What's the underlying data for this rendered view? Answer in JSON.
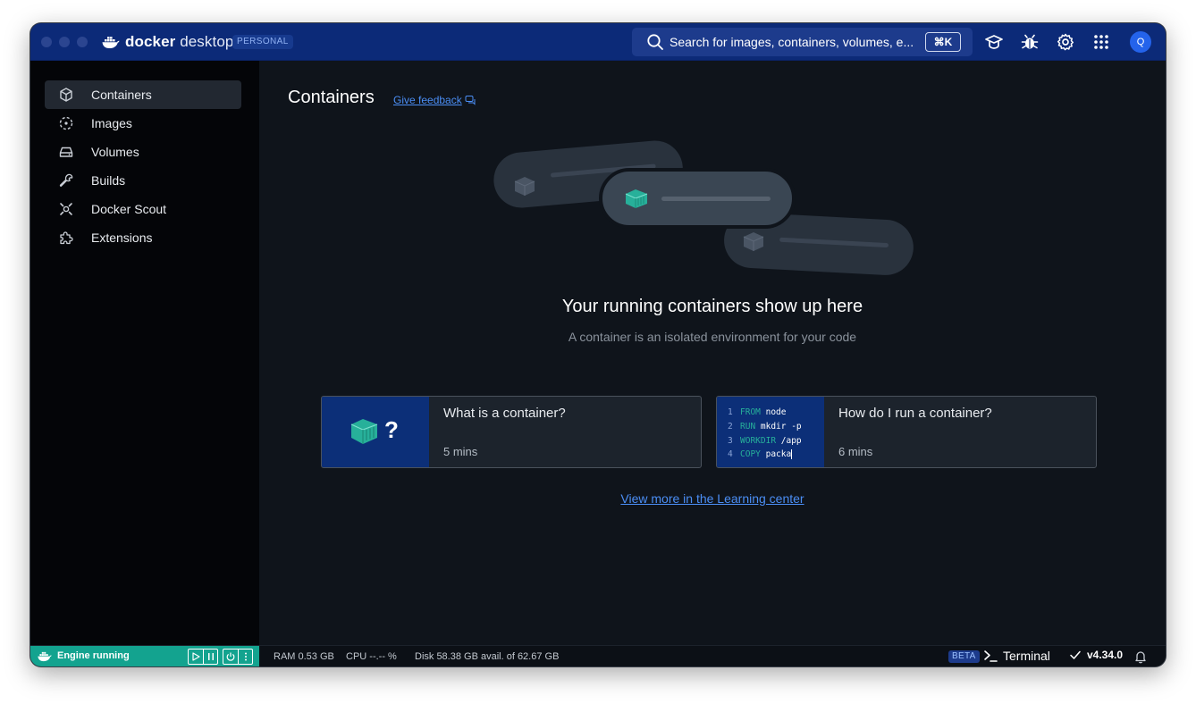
{
  "app": {
    "brand": "docker desktop",
    "brand_bold": "docker",
    "brand_light": "desktop",
    "plan_badge": "PERSONAL"
  },
  "header": {
    "search_placeholder": "Search for images, containers, volumes, e...",
    "search_shortcut": "⌘K",
    "avatar_initial": "Q"
  },
  "sidebar": {
    "items": [
      {
        "label": "Containers",
        "icon": "cube-icon",
        "active": true
      },
      {
        "label": "Images",
        "icon": "image-layers-icon",
        "active": false
      },
      {
        "label": "Volumes",
        "icon": "drive-icon",
        "active": false
      },
      {
        "label": "Builds",
        "icon": "wrench-icon",
        "active": false
      },
      {
        "label": "Docker Scout",
        "icon": "scout-icon",
        "active": false
      },
      {
        "label": "Extensions",
        "icon": "puzzle-icon",
        "active": false
      }
    ]
  },
  "main": {
    "title": "Containers",
    "feedback_link": "Give feedback",
    "empty_title": "Your running containers show up here",
    "empty_subtitle": "A container is an isolated environment for your code",
    "cards": [
      {
        "title": "What is a container?",
        "meta": "5 mins",
        "thumb_glyph": "?"
      },
      {
        "title": "How do I run a container?",
        "meta": "6 mins"
      }
    ],
    "code_lines": [
      {
        "num": "1",
        "kw": "FROM",
        "rest": " node"
      },
      {
        "num": "2",
        "kw": "RUN",
        "rest": " mkdir -p"
      },
      {
        "num": "3",
        "kw": "WORKDIR",
        "rest": " /app"
      },
      {
        "num": "4",
        "kw": "COPY",
        "rest": " packa"
      }
    ],
    "learning_link": "View more in the Learning center"
  },
  "statusbar": {
    "engine_status": "Engine running",
    "ram": "RAM 0.53 GB",
    "cpu": "CPU --.-- %",
    "disk": "Disk 58.38 GB avail. of 62.67 GB",
    "beta_badge": "BETA",
    "terminal": "Terminal",
    "version": "v4.34.0"
  },
  "colors": {
    "titlebar": "#0c2a78",
    "accent": "#2463eb",
    "engine_green": "#13a38f",
    "teal_cube": "#27b09a",
    "link": "#4b8ef5"
  }
}
